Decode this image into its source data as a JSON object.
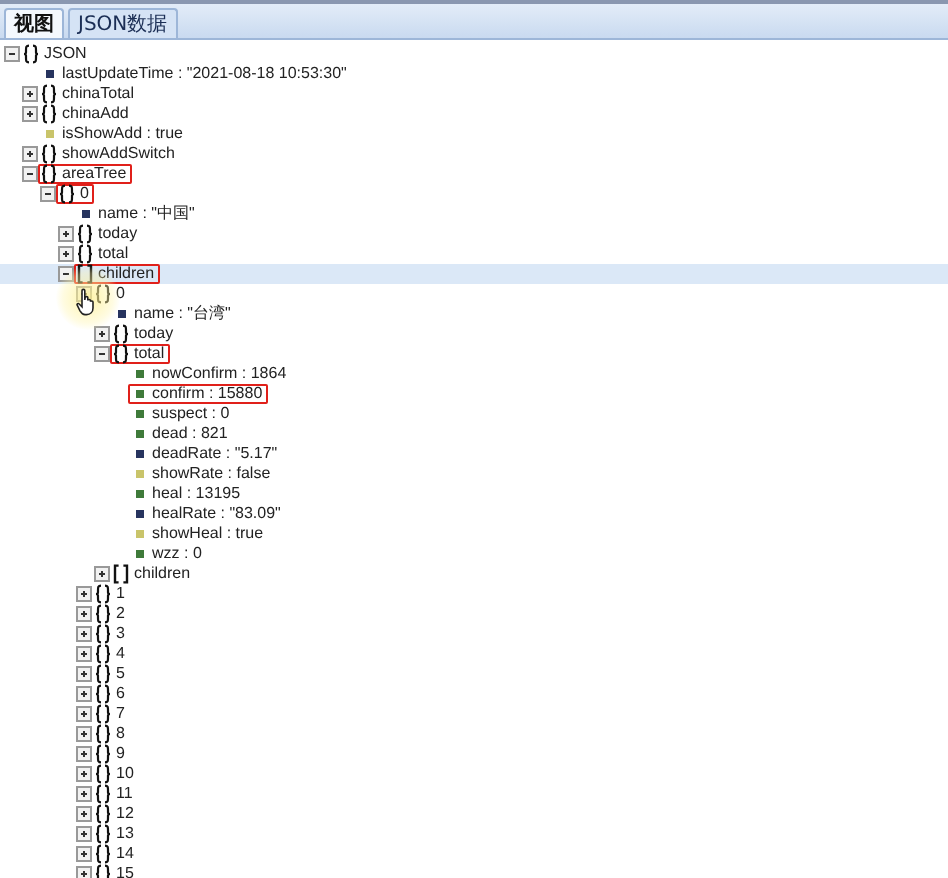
{
  "tabs": [
    {
      "label": "视图",
      "selected": true
    },
    {
      "label": "JSON数据",
      "selected": false
    }
  ],
  "tree": {
    "label": "JSON",
    "kind": "object",
    "expanded": true,
    "selected": false,
    "highlighted": false,
    "children": [
      {
        "label": "lastUpdateTime : \"2021-08-18 10:53:30\"",
        "kind": "string",
        "selected": false,
        "highlighted": false
      },
      {
        "label": "chinaTotal",
        "kind": "object",
        "expanded": false,
        "selected": false,
        "highlighted": false
      },
      {
        "label": "chinaAdd",
        "kind": "object",
        "expanded": false,
        "selected": false,
        "highlighted": false
      },
      {
        "label": "isShowAdd : true",
        "kind": "boolean",
        "selected": false,
        "highlighted": false
      },
      {
        "label": "showAddSwitch",
        "kind": "object",
        "expanded": false,
        "selected": false,
        "highlighted": false
      },
      {
        "label": "areaTree",
        "kind": "object",
        "expanded": true,
        "selected": false,
        "highlighted": true,
        "children": [
          {
            "label": "0",
            "kind": "object",
            "expanded": true,
            "selected": false,
            "highlighted": true,
            "children": [
              {
                "label": "name : \"中国\"",
                "kind": "string",
                "selected": false,
                "highlighted": false
              },
              {
                "label": "today",
                "kind": "object",
                "expanded": false,
                "selected": false,
                "highlighted": false
              },
              {
                "label": "total",
                "kind": "object",
                "expanded": false,
                "selected": false,
                "highlighted": false
              },
              {
                "label": "children",
                "kind": "array",
                "expanded": true,
                "selected": true,
                "highlighted": true,
                "children": [
                  {
                    "label": "0",
                    "kind": "object",
                    "expanded": true,
                    "selected": false,
                    "highlighted": false,
                    "children": [
                      {
                        "label": "name : \"台湾\"",
                        "kind": "string",
                        "selected": false,
                        "highlighted": false
                      },
                      {
                        "label": "today",
                        "kind": "object",
                        "expanded": false,
                        "selected": false,
                        "highlighted": false
                      },
                      {
                        "label": "total",
                        "kind": "object",
                        "expanded": true,
                        "selected": false,
                        "highlighted": true,
                        "children": [
                          {
                            "label": "nowConfirm : 1864",
                            "kind": "number",
                            "selected": false,
                            "highlighted": false
                          },
                          {
                            "label": "confirm : 15880",
                            "kind": "number",
                            "selected": false,
                            "highlighted": true
                          },
                          {
                            "label": "suspect : 0",
                            "kind": "number",
                            "selected": false,
                            "highlighted": false
                          },
                          {
                            "label": "dead : 821",
                            "kind": "number",
                            "selected": false,
                            "highlighted": false
                          },
                          {
                            "label": "deadRate : \"5.17\"",
                            "kind": "string",
                            "selected": false,
                            "highlighted": false
                          },
                          {
                            "label": "showRate : false",
                            "kind": "boolean",
                            "selected": false,
                            "highlighted": false
                          },
                          {
                            "label": "heal : 13195",
                            "kind": "number",
                            "selected": false,
                            "highlighted": false
                          },
                          {
                            "label": "healRate : \"83.09\"",
                            "kind": "string",
                            "selected": false,
                            "highlighted": false
                          },
                          {
                            "label": "showHeal : true",
                            "kind": "boolean",
                            "selected": false,
                            "highlighted": false
                          },
                          {
                            "label": "wzz : 0",
                            "kind": "number",
                            "selected": false,
                            "highlighted": false
                          }
                        ]
                      },
                      {
                        "label": "children",
                        "kind": "array",
                        "expanded": false,
                        "selected": false,
                        "highlighted": false
                      }
                    ]
                  },
                  {
                    "label": "1",
                    "kind": "object",
                    "expanded": false,
                    "selected": false,
                    "highlighted": false
                  },
                  {
                    "label": "2",
                    "kind": "object",
                    "expanded": false,
                    "selected": false,
                    "highlighted": false
                  },
                  {
                    "label": "3",
                    "kind": "object",
                    "expanded": false,
                    "selected": false,
                    "highlighted": false
                  },
                  {
                    "label": "4",
                    "kind": "object",
                    "expanded": false,
                    "selected": false,
                    "highlighted": false
                  },
                  {
                    "label": "5",
                    "kind": "object",
                    "expanded": false,
                    "selected": false,
                    "highlighted": false
                  },
                  {
                    "label": "6",
                    "kind": "object",
                    "expanded": false,
                    "selected": false,
                    "highlighted": false
                  },
                  {
                    "label": "7",
                    "kind": "object",
                    "expanded": false,
                    "selected": false,
                    "highlighted": false
                  },
                  {
                    "label": "8",
                    "kind": "object",
                    "expanded": false,
                    "selected": false,
                    "highlighted": false
                  },
                  {
                    "label": "9",
                    "kind": "object",
                    "expanded": false,
                    "selected": false,
                    "highlighted": false
                  },
                  {
                    "label": "10",
                    "kind": "object",
                    "expanded": false,
                    "selected": false,
                    "highlighted": false
                  },
                  {
                    "label": "11",
                    "kind": "object",
                    "expanded": false,
                    "selected": false,
                    "highlighted": false
                  },
                  {
                    "label": "12",
                    "kind": "object",
                    "expanded": false,
                    "selected": false,
                    "highlighted": false
                  },
                  {
                    "label": "13",
                    "kind": "object",
                    "expanded": false,
                    "selected": false,
                    "highlighted": false
                  },
                  {
                    "label": "14",
                    "kind": "object",
                    "expanded": false,
                    "selected": false,
                    "highlighted": false
                  },
                  {
                    "label": "15",
                    "kind": "object",
                    "expanded": false,
                    "selected": false,
                    "highlighted": false
                  }
                ]
              }
            ]
          }
        ]
      }
    ]
  }
}
